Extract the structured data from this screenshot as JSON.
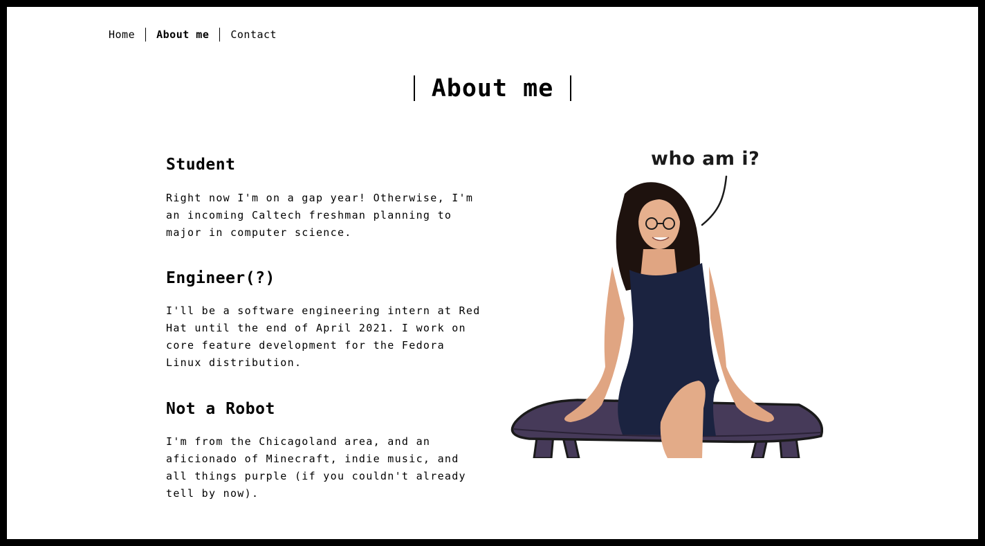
{
  "nav": {
    "items": [
      {
        "label": "Home",
        "active": false
      },
      {
        "label": "About me",
        "active": true
      },
      {
        "label": "Contact",
        "active": false
      }
    ]
  },
  "page_title": "About me",
  "sections": [
    {
      "heading": "Student",
      "body": "Right now I'm on a gap year! Otherwise, I'm an incoming Caltech freshman planning to major in computer science."
    },
    {
      "heading": "Engineer(?)",
      "body": "I'll be a software engineering intern at Red Hat until the end of April 2021. I work on core feature development for the Fedora Linux distribution."
    },
    {
      "heading": "Not a Robot",
      "body": "I'm from the Chicagoland area, and an aficionado of Minecraft, indie music, and all things purple (if you couldn't already tell by now)."
    }
  ],
  "illustration": {
    "caption": "who am i?",
    "bench_color": "#463a59",
    "dress_color": "#1b2340"
  }
}
